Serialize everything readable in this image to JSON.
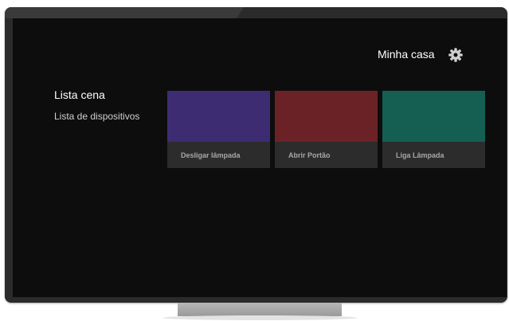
{
  "header": {
    "title": "Minha casa",
    "settings_icon": "gear-icon"
  },
  "nav": {
    "items": [
      {
        "label": "Lista cena",
        "active": true
      },
      {
        "label": "Lista de dispositivos",
        "active": false
      }
    ]
  },
  "cards": [
    {
      "label": "Desligar lâmpada",
      "color": "#3d2c72"
    },
    {
      "label": "Abrir Portão",
      "color": "#6b2227"
    },
    {
      "label": "Liga Lâmpada",
      "color": "#145f52"
    }
  ]
}
